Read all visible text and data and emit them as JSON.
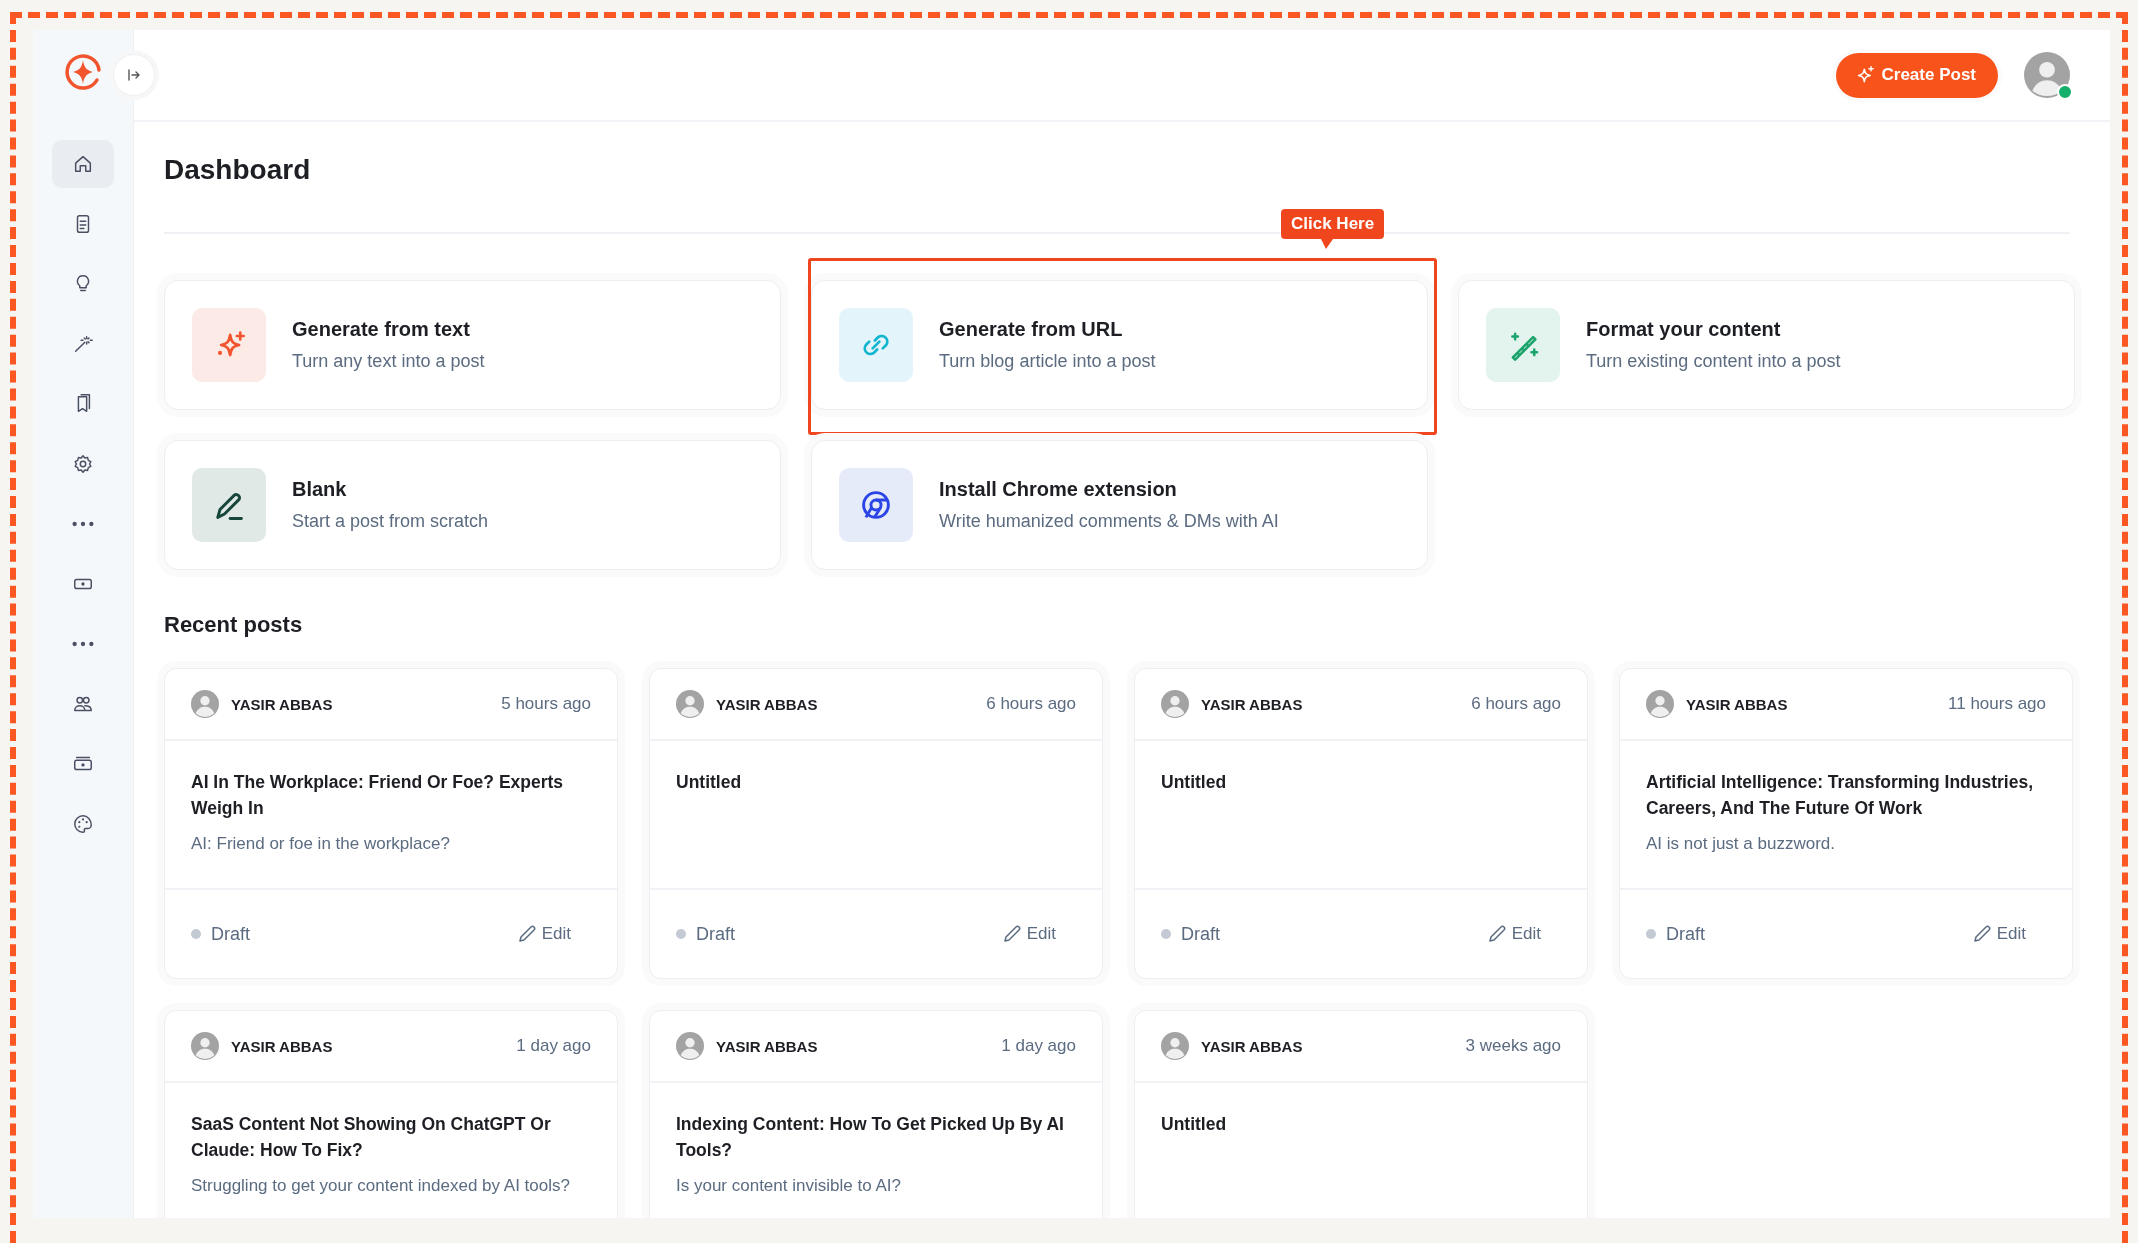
{
  "sidebar": {
    "items": [
      {
        "kind": "link",
        "selected": true
      },
      {
        "kind": "link",
        "selected": false
      },
      {
        "kind": "link",
        "selected": false
      },
      {
        "kind": "link",
        "selected": false
      },
      {
        "kind": "link",
        "selected": false
      },
      {
        "kind": "link",
        "selected": false
      },
      {
        "kind": "more",
        "selected": false
      },
      {
        "kind": "link",
        "selected": false
      },
      {
        "kind": "more",
        "selected": false
      },
      {
        "kind": "link",
        "selected": false
      },
      {
        "kind": "link",
        "selected": false
      },
      {
        "kind": "link",
        "selected": false
      }
    ]
  },
  "topbar": {
    "create_button": "Create Post",
    "avatar": {
      "online": true
    }
  },
  "page_title": "Dashboard",
  "actions": [
    {
      "title": "Generate from text",
      "subtitle": "Turn any text into a post",
      "highlighted": false
    },
    {
      "title": "Generate from URL",
      "subtitle": "Turn blog article into a post",
      "highlighted": true,
      "callout": "Click Here"
    },
    {
      "title": "Format your content",
      "subtitle": "Turn existing content into a post",
      "highlighted": false
    },
    {
      "title": "Blank",
      "subtitle": "Start a post from scratch",
      "highlighted": false
    },
    {
      "title": "Install Chrome extension",
      "subtitle": "Write humanized comments & DMs with AI",
      "highlighted": false
    }
  ],
  "recent_posts": {
    "title": "Recent posts",
    "posts": [
      {
        "author": "YASIR ABBAS",
        "time": "5 hours ago",
        "title": "AI In The Workplace: Friend Or Foe? Experts Weigh In",
        "excerpt": "AI: Friend or foe in the workplace?",
        "status": "Draft",
        "edit": "Edit"
      },
      {
        "author": "YASIR ABBAS",
        "time": "6 hours ago",
        "title": "Untitled",
        "status": "Draft",
        "edit": "Edit"
      },
      {
        "author": "YASIR ABBAS",
        "time": "6 hours ago",
        "title": "Untitled",
        "status": "Draft",
        "edit": "Edit"
      },
      {
        "author": "YASIR ABBAS",
        "time": "11 hours ago",
        "title": "Artificial Intelligence: Transforming Industries, Careers, And The Future Of Work",
        "excerpt": "AI is not just a buzzword.",
        "status": "Draft",
        "edit": "Edit"
      },
      {
        "author": "YASIR ABBAS",
        "time": "1 day ago",
        "title": "SaaS Content Not Showing On ChatGPT Or Claude: How To Fix?",
        "excerpt": "Struggling to get your content indexed by AI tools?"
      },
      {
        "author": "YASIR ABBAS",
        "time": "1 day ago",
        "title": "Indexing Content: How To Get Picked Up By AI Tools?",
        "excerpt": "Is your content invisible to AI?"
      },
      {
        "author": "YASIR ABBAS",
        "time": "3 weeks ago",
        "title": "Untitled"
      }
    ]
  }
}
